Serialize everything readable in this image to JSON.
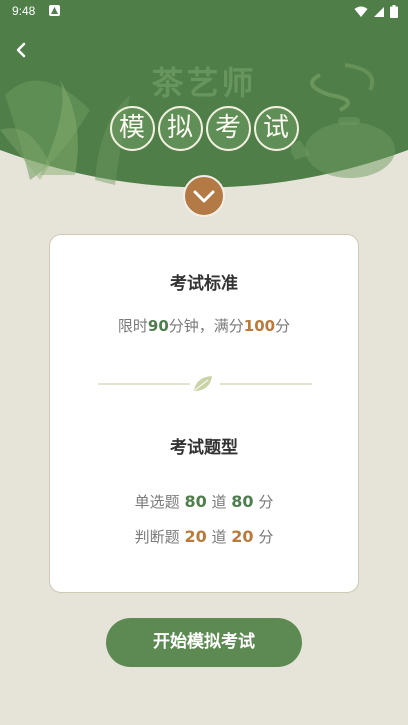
{
  "status_bar": {
    "time": "9:48"
  },
  "header": {
    "title_top": "茶艺师",
    "title_chars": [
      "模",
      "拟",
      "考",
      "试"
    ]
  },
  "card": {
    "standard": {
      "title": "考试标准",
      "prefix": "限时",
      "time_value": "90",
      "middle": "分钟，满分",
      "score_value": "100",
      "suffix": "分"
    },
    "types": {
      "title": "考试题型",
      "rows": [
        {
          "label": "单选题",
          "count": "80",
          "unit": "道",
          "score": "80",
          "score_unit": "分"
        },
        {
          "label": "判断题",
          "count": "20",
          "unit": "道",
          "score": "20",
          "score_unit": "分"
        }
      ]
    }
  },
  "start_button": {
    "label": "开始模拟考试"
  },
  "colors": {
    "primary_green": "#5d8a52",
    "accent_orange": "#b97a3b",
    "page_bg": "#e6e4d9"
  }
}
